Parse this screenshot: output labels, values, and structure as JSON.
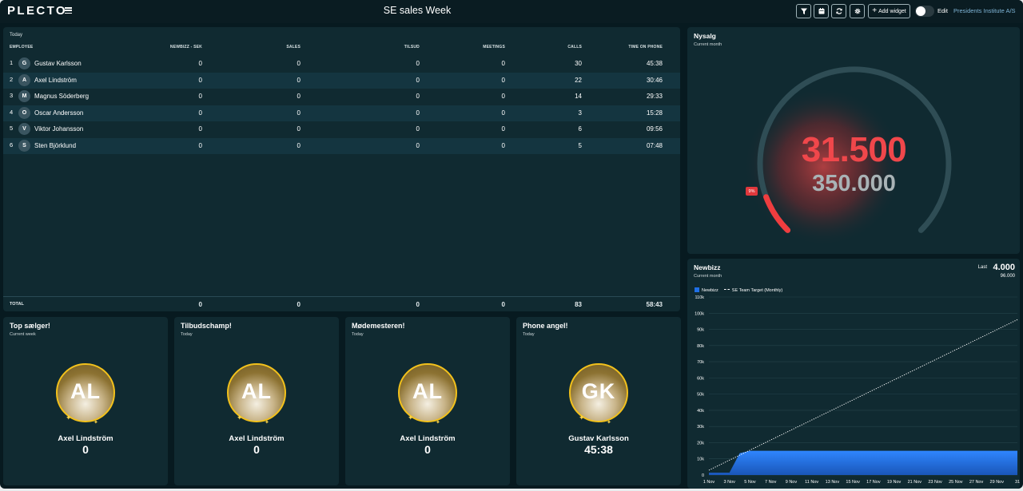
{
  "app": {
    "logo": "PLECTO",
    "title": "SE sales Week",
    "add_widget": "Add widget",
    "edit": "Edit",
    "org": "Presidents Institute A/S"
  },
  "table": {
    "caption": "Today",
    "headers": [
      "EMPLOYEE",
      "NEWBIZZ - SEK",
      "SALES",
      "TILSUD",
      "MEETINGS",
      "CALLS",
      "TIME ON PHONE"
    ],
    "rows": [
      {
        "rank": "1",
        "initial": "G",
        "name": "Gustav Karlsson",
        "newbizz": "0",
        "sales": "0",
        "tilsud": "0",
        "meetings": "0",
        "calls": "30",
        "time": "45:38"
      },
      {
        "rank": "2",
        "initial": "A",
        "name": "Axel Lindström",
        "newbizz": "0",
        "sales": "0",
        "tilsud": "0",
        "meetings": "0",
        "calls": "22",
        "time": "30:46"
      },
      {
        "rank": "3",
        "initial": "M",
        "name": "Magnus Söderberg",
        "newbizz": "0",
        "sales": "0",
        "tilsud": "0",
        "meetings": "0",
        "calls": "14",
        "time": "29:33"
      },
      {
        "rank": "4",
        "initial": "O",
        "name": "Oscar Andersson",
        "newbizz": "0",
        "sales": "0",
        "tilsud": "0",
        "meetings": "0",
        "calls": "3",
        "time": "15:28"
      },
      {
        "rank": "5",
        "initial": "V",
        "name": "Viktor Johansson",
        "newbizz": "0",
        "sales": "0",
        "tilsud": "0",
        "meetings": "0",
        "calls": "6",
        "time": "09:56"
      },
      {
        "rank": "6",
        "initial": "S",
        "name": "Sten Björklund",
        "newbizz": "0",
        "sales": "0",
        "tilsud": "0",
        "meetings": "0",
        "calls": "5",
        "time": "07:48"
      }
    ],
    "total": {
      "label": "TOTAL",
      "newbizz": "0",
      "sales": "0",
      "tilsud": "0",
      "meetings": "0",
      "calls": "83",
      "time": "58:43"
    }
  },
  "gauge": {
    "title": "Nysalg",
    "subtitle": "Current month",
    "value": "31.500",
    "target": "350.000",
    "percent_label": "9%",
    "fraction": 0.09,
    "colors": {
      "value": "#f0474b",
      "track": "#2f4d55"
    }
  },
  "newbizz": {
    "title": "Newbizz",
    "subtitle": "Current month",
    "last_label": "Last",
    "last_value": "4.000",
    "last_target": "96.000"
  },
  "chart_data": {
    "type": "area",
    "series": [
      {
        "name": "Newbizz",
        "color": "#1f6fe6",
        "x": [
          1,
          2,
          3,
          4,
          5,
          6,
          7,
          8,
          9,
          10,
          11,
          12,
          13,
          14,
          15,
          16,
          17,
          18,
          19,
          20,
          21,
          22,
          23,
          24,
          25,
          26,
          27,
          28,
          29,
          30,
          31
        ],
        "values": [
          1500,
          1500,
          1500,
          13500,
          15000,
          15000,
          15000,
          15000,
          15000,
          15000,
          15000,
          15000,
          15000,
          15000,
          15000,
          15000,
          15000,
          15000,
          15000,
          15000,
          15000,
          15000,
          15000,
          15000,
          15000,
          15000,
          15000,
          15000,
          15000,
          15000,
          15000
        ]
      },
      {
        "name": "SE Team Target (Monthly)",
        "style": "dotted",
        "x": [
          1,
          31
        ],
        "values": [
          3000,
          96000
        ]
      }
    ],
    "y_ticks": [
      "0",
      "10k",
      "20k",
      "30k",
      "40k",
      "50k",
      "60k",
      "70k",
      "80k",
      "90k",
      "100k",
      "110k"
    ],
    "x_ticks": [
      "1 Nov",
      "3 Nov",
      "5 Nov",
      "7 Nov",
      "9 Nov",
      "11 Nov",
      "13 Nov",
      "15 Nov",
      "17 Nov",
      "19 Nov",
      "21 Nov",
      "23 Nov",
      "25 Nov",
      "27 Nov",
      "29 Nov",
      "31"
    ],
    "ylim": [
      0,
      110000
    ],
    "xlim": [
      1,
      31
    ]
  },
  "cards": [
    {
      "title": "Top sælger!",
      "subtitle": "Current week",
      "initials": "AL",
      "name": "Axel Lindström",
      "value": "0"
    },
    {
      "title": "Tilbudschamp!",
      "subtitle": "Today",
      "initials": "AL",
      "name": "Axel Lindström",
      "value": "0"
    },
    {
      "title": "Mødemesteren!",
      "subtitle": "Today",
      "initials": "AL",
      "name": "Axel Lindström",
      "value": "0"
    },
    {
      "title": "Phone angel!",
      "subtitle": "Today",
      "initials": "GK",
      "name": "Gustav Karlsson",
      "value": "45:38"
    }
  ]
}
